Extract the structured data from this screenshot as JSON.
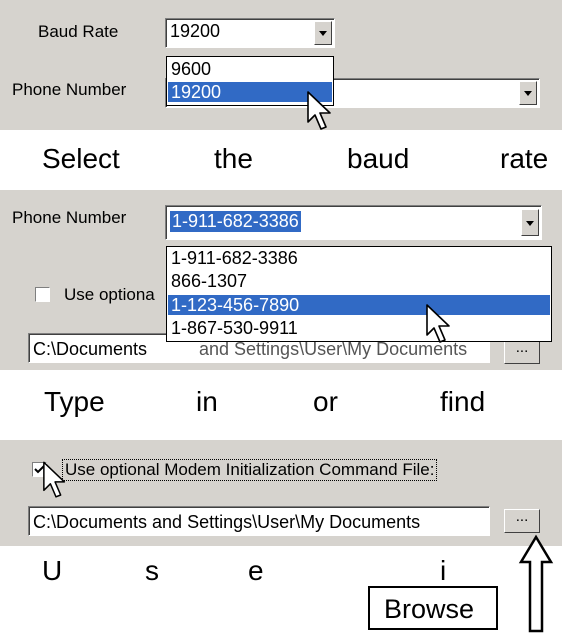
{
  "panel1": {
    "baud_label": "Baud Rate",
    "baud_value": "19200",
    "baud_options": [
      "9600",
      "19200"
    ],
    "phone_label": "Phone Number"
  },
  "caption1": [
    "Select",
    "the",
    "baud",
    "rate"
  ],
  "panel2": {
    "phone_label": "Phone Number",
    "phone_value": "1-911-682-3386",
    "phone_options": [
      "1-911-682-3386",
      "866-1307",
      "1-123-456-7890",
      "1-867-530-9911"
    ],
    "optional_label_partial": "Use optiona",
    "path_partial_left": "C:\\Documents",
    "path_partial_right": "and Settings\\User\\My Documents",
    "browse_label": "..."
  },
  "caption2": [
    "Type",
    "in",
    "or",
    "find"
  ],
  "panel3": {
    "optional_label": "Use optional Modem Initialization Command File:",
    "path_value": "C:\\Documents and Settings\\User\\My Documents",
    "browse_label": "..."
  },
  "caption3": [
    "U",
    "s",
    "e",
    "i"
  ],
  "browse_callout": "Browse",
  "colors": {
    "panel": "#d6d3ce",
    "selection": "#316ac5"
  }
}
